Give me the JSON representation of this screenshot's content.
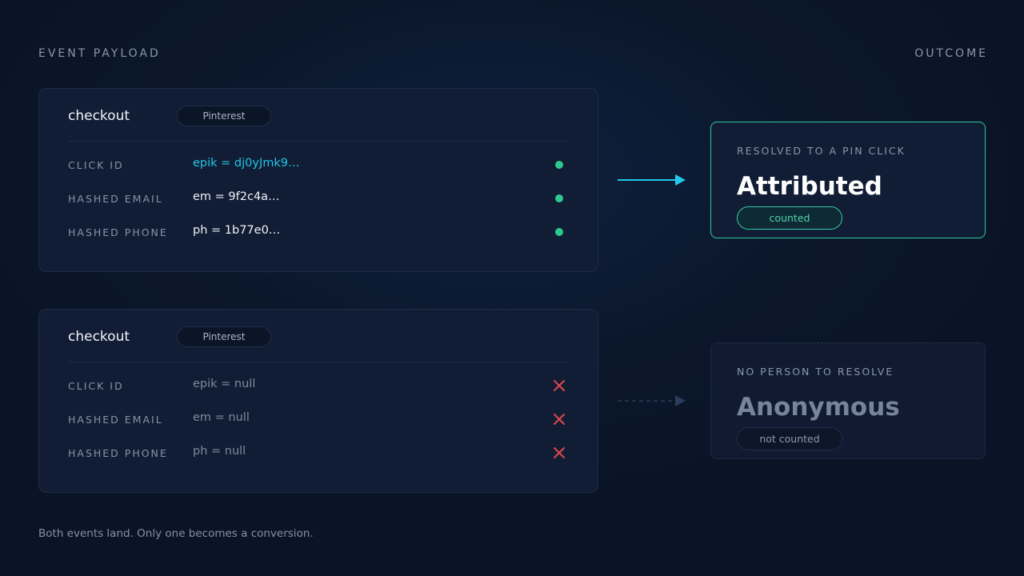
{
  "headers": {
    "left": "EVENT PAYLOAD",
    "right": "OUTCOME"
  },
  "events": [
    {
      "title": "checkout",
      "platform": "Pinterest",
      "rows": [
        {
          "label": "CLICK ID",
          "value": "epik = dj0yJmk9…",
          "status": "present",
          "value_color": "#22c7e9"
        },
        {
          "label": "HASHED EMAIL",
          "value": "em = 9f2c4a…",
          "status": "present"
        },
        {
          "label": "HASHED PHONE",
          "value": "ph = 1b77e0…",
          "status": "present"
        }
      ]
    },
    {
      "title": "checkout",
      "platform": "Pinterest",
      "rows": [
        {
          "label": "CLICK ID",
          "value": "epik = null",
          "status": "missing"
        },
        {
          "label": "HASHED EMAIL",
          "value": "em = null",
          "status": "missing"
        },
        {
          "label": "HASHED PHONE",
          "value": "ph = null",
          "status": "missing"
        }
      ]
    }
  ],
  "outcomes": [
    {
      "label": "RESOLVED TO A PIN CLICK",
      "title": "Attributed",
      "badge": "counted",
      "accent": "#35c7a0"
    },
    {
      "label": "NO PERSON TO RESOLVE",
      "title": "Anonymous",
      "badge": "not counted",
      "accent": "#78849a"
    }
  ],
  "footer": "Both events land. Only one becomes a conversion.",
  "colors": {
    "present": "#2ec990",
    "missing": "#e0474c",
    "arrow_active": "#22c7e9",
    "arrow_inactive": "#2a3c5c"
  }
}
